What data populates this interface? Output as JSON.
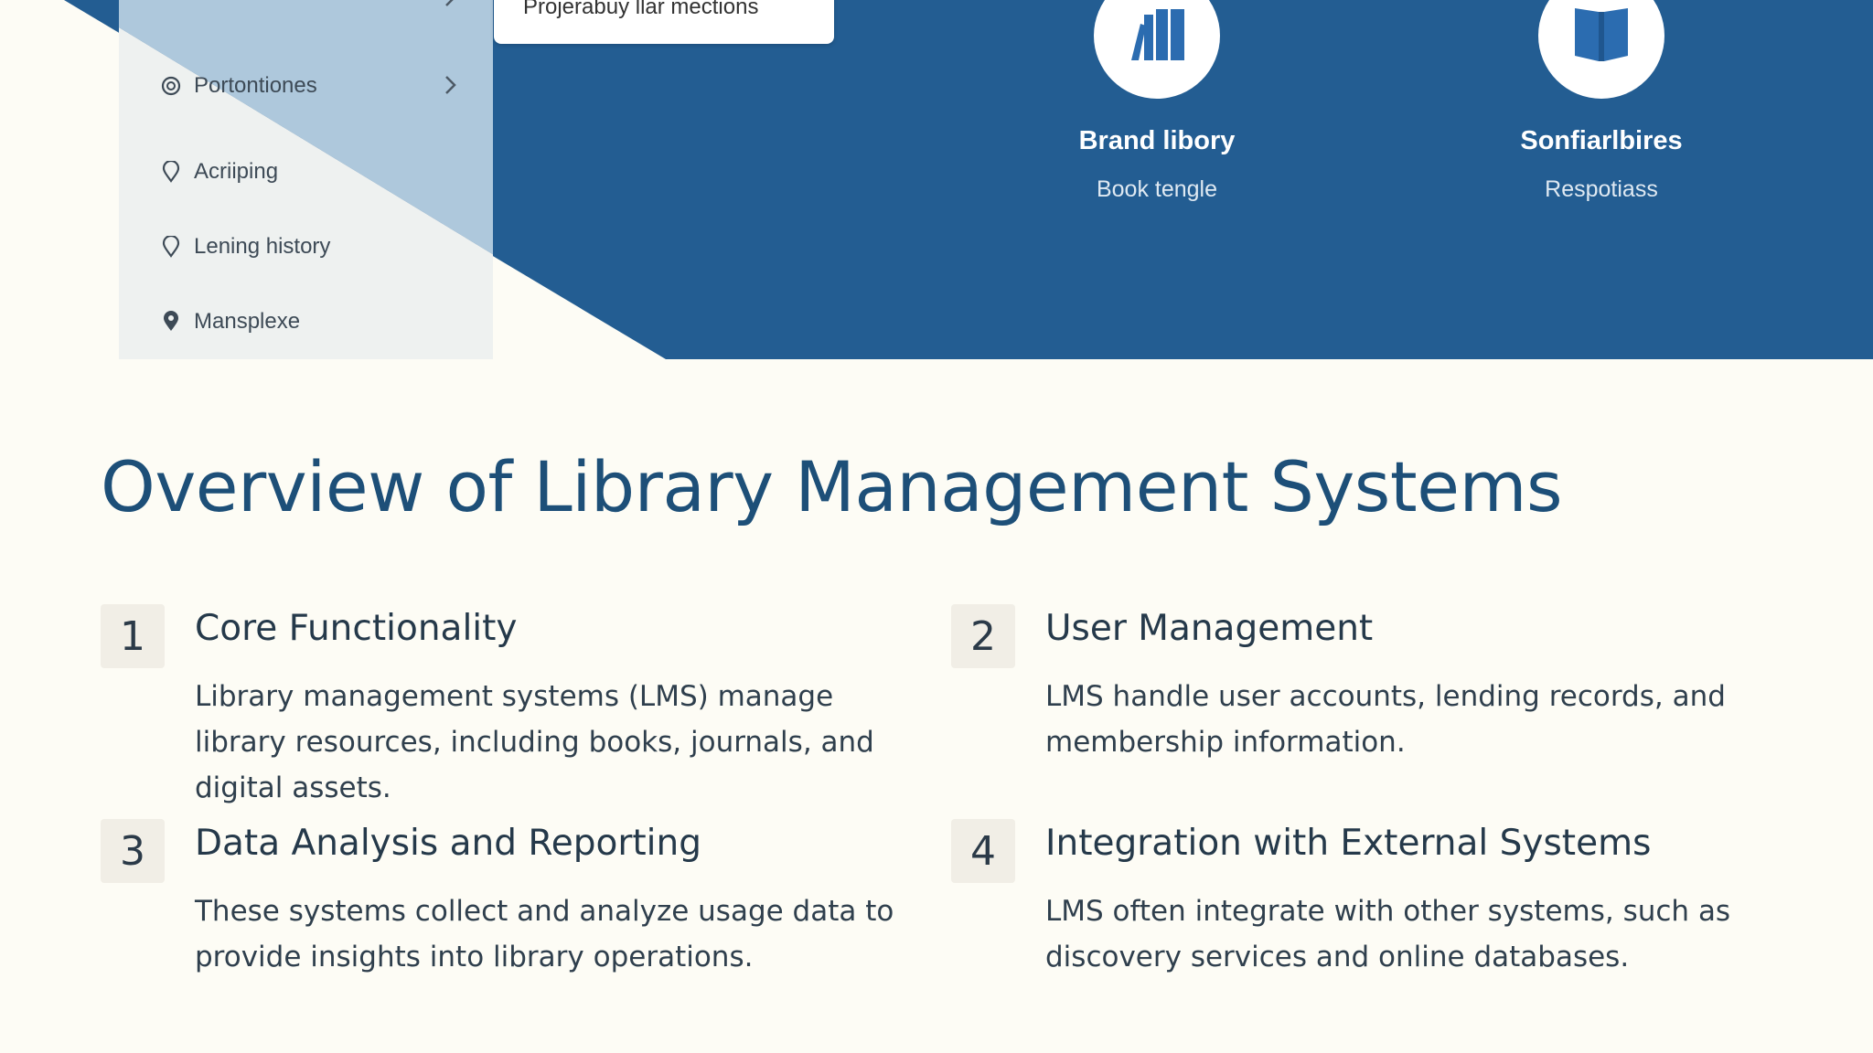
{
  "hero": {
    "sidebar": {
      "items": [
        {
          "label": "Portontiones",
          "icon": "settings-icon"
        },
        {
          "label": "Acriiping",
          "icon": "location-pin-icon"
        },
        {
          "label": "Lening history",
          "icon": "location-pin-icon"
        },
        {
          "label": "Mansplexe",
          "icon": "location-pin-filled-icon"
        }
      ]
    },
    "tooltip": "Projerabuy llar mections",
    "features": [
      {
        "title": "Brand libory",
        "subtitle": "Book tengle",
        "icon": "books-icon"
      },
      {
        "title": "Sonfiarlbires",
        "subtitle": "Respotiass",
        "icon": "open-book-icon"
      }
    ],
    "colors": {
      "banner": "#235d92",
      "panel": "#aec8dc"
    }
  },
  "page": {
    "title": "Overview of Library Management Systems",
    "colors": {
      "title": "#1d4f78",
      "background": "#fdfcf5"
    }
  },
  "cards": [
    {
      "number": "1",
      "title": "Core Functionality",
      "description": "Library management systems (LMS) manage library resources, including books, journals, and digital assets."
    },
    {
      "number": "2",
      "title": "User Management",
      "description": "LMS handle user accounts, lending records, and membership information."
    },
    {
      "number": "3",
      "title": "Data Analysis and Reporting",
      "description": "These systems collect and analyze usage data to provide insights into library operations."
    },
    {
      "number": "4",
      "title": "Integration with External Systems",
      "description": "LMS often integrate with other systems, such as discovery services and online databases."
    }
  ]
}
